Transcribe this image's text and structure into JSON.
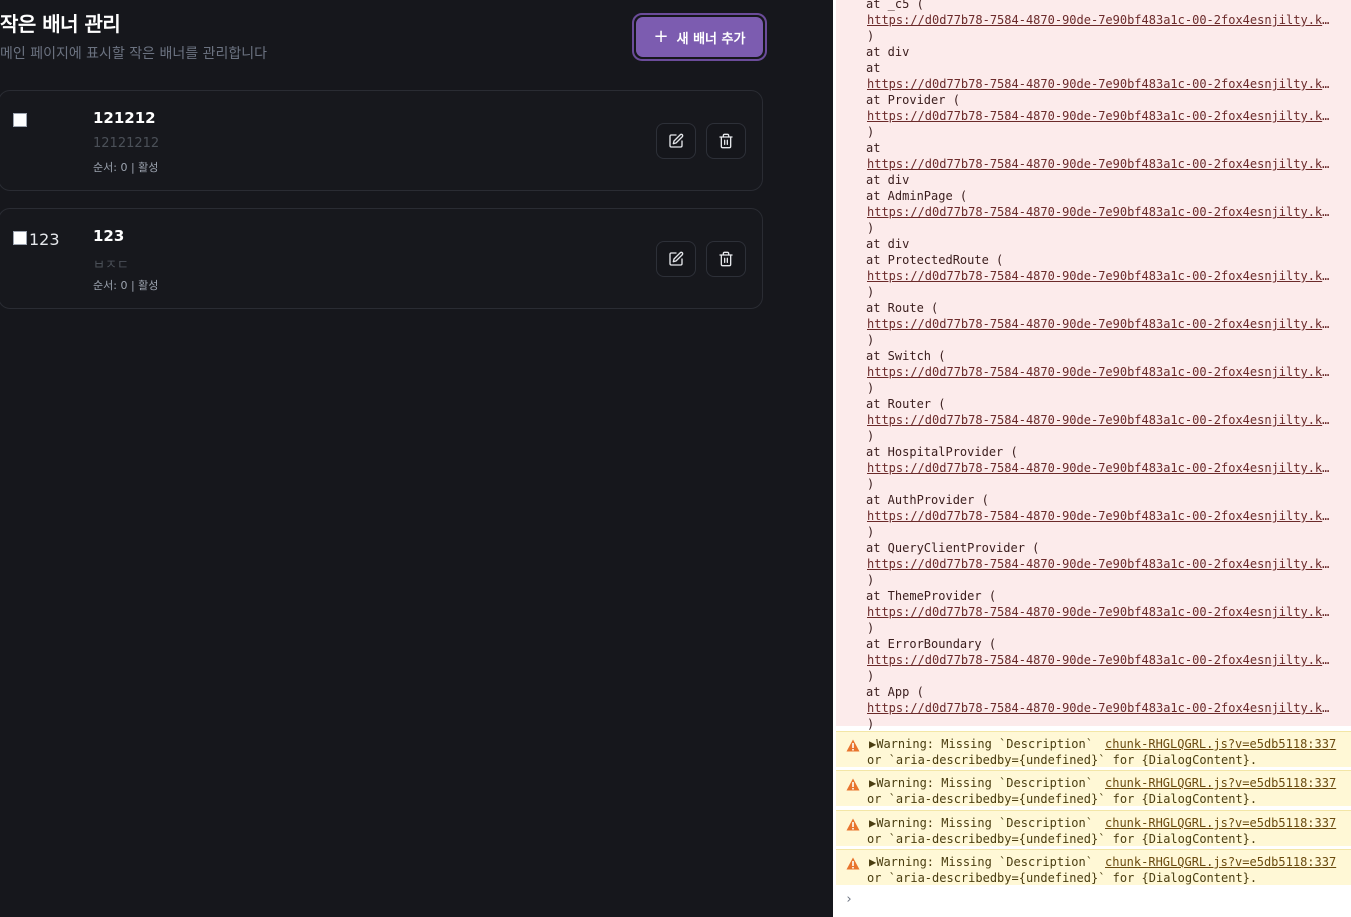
{
  "header": {
    "title": "작은 배너 관리",
    "subtitle": "메인 페이지에 표시할 작은 배너를 관리합니다",
    "add_button_label": "새 배너 추가"
  },
  "banners": [
    {
      "image_alt": "121212",
      "title": "121212",
      "description": "12121212",
      "meta": "순서: 0 | 활성"
    },
    {
      "image_alt": "123",
      "title": "123",
      "description": "ㅂㅈㄷ",
      "meta": "순서: 0 | 활성"
    }
  ],
  "console": {
    "trace": [
      {
        "at": "at _c5 (",
        "link": "https://d0d77b78-7584-4870-90de-7e90bf483a1c-00-2fox4esnjilty.kirk.replit.dev/src/components/ui/dialog.tsx",
        "close": ")"
      },
      {
        "at": "at div",
        "link": null,
        "close": null
      },
      {
        "at": "at",
        "link": "https://d0d77b78-7584-4870-90de-7e90bf483a1c-00-2fox4esnjilty.kirk.replit.dev/node_modules/.vite/deps/chunk.js",
        "close": null
      },
      {
        "at": "at Provider (",
        "link": "https://d0d77b78-7584-4870-90de-7e90bf483a1c-00-2fox4esnjilty.kirk.replit.dev/node_modules/.vite/deps/chunk.js",
        "close": ")"
      },
      {
        "at": "at",
        "link": "https://d0d77b78-7584-4870-90de-7e90bf483a1c-00-2fox4esnjilty.kirk.replit.dev/node_modules/.vite/deps/chunk.js",
        "close": null
      },
      {
        "at": "at div",
        "link": null,
        "close": null
      },
      {
        "at": "at AdminPage (",
        "link": "https://d0d77b78-7584-4870-90de-7e90bf483a1c-00-2fox4esnjilty.kirk.replit.dev/src/pages/admin.tsx",
        "close": ")"
      },
      {
        "at": "at div",
        "link": null,
        "close": null
      },
      {
        "at": "at ProtectedRoute (",
        "link": "https://d0d77b78-7584-4870-90de-7e90bf483a1c-00-2fox4esnjilty.kirk.replit.dev/src/lib/protected-route.tsx",
        "close": ")"
      },
      {
        "at": "at Route (",
        "link": "https://d0d77b78-7584-4870-90de-7e90bf483a1c-00-2fox4esnjilty.kirk.replit.dev/node_modules/.vite/deps/wouter.js",
        "close": ")"
      },
      {
        "at": "at Switch (",
        "link": "https://d0d77b78-7584-4870-90de-7e90bf483a1c-00-2fox4esnjilty.kirk.replit.dev/node_modules/.vite/deps/wouter.js",
        "close": ")"
      },
      {
        "at": "at Router (",
        "link": "https://d0d77b78-7584-4870-90de-7e90bf483a1c-00-2fox4esnjilty.kirk.replit.dev/src/App.tsx",
        "close": ")"
      },
      {
        "at": "at HospitalProvider (",
        "link": "https://d0d77b78-7584-4870-90de-7e90bf483a1c-00-2fox4esnjilty.kirk.replit.dev/src/hooks/use-hospital.tsx",
        "close": ")"
      },
      {
        "at": "at AuthProvider (",
        "link": "https://d0d77b78-7584-4870-90de-7e90bf483a1c-00-2fox4esnjilty.kirk.replit.dev/src/hooks/use-auth.tsx",
        "close": ")"
      },
      {
        "at": "at QueryClientProvider (",
        "link": "https://d0d77b78-7584-4870-90de-7e90bf483a1c-00-2fox4esnjilty.kirk.replit.dev/node_modules/.vite/deps/@tanstack_react-query.js",
        "close": ")"
      },
      {
        "at": "at ThemeProvider (",
        "link": "https://d0d77b78-7584-4870-90de-7e90bf483a1c-00-2fox4esnjilty.kirk.replit.dev/src/components/theme-provider.tsx",
        "close": ")"
      },
      {
        "at": "at ErrorBoundary (",
        "link": "https://d0d77b78-7584-4870-90de-7e90bf483a1c-00-2fox4esnjilty.kirk.replit.dev/src/components/error-boundary.tsx",
        "close": ")"
      },
      {
        "at": "at App (",
        "link": "https://d0d77b78-7584-4870-90de-7e90bf483a1c-00-2fox4esnjilty.kirk.replit.dev/src/App.tsx",
        "close": ")"
      }
    ],
    "warnings": [
      {
        "line1": "▶Warning: Missing `Description`",
        "line2": "or `aria-describedby={undefined}` for {DialogContent}.",
        "source": "chunk-RHGLQGRL.js?v=e5db5118:337"
      },
      {
        "line1": "▶Warning: Missing `Description`",
        "line2": "or `aria-describedby={undefined}` for {DialogContent}.",
        "source": "chunk-RHGLQGRL.js?v=e5db5118:337"
      },
      {
        "line1": "▶Warning: Missing `Description`",
        "line2": "or `aria-describedby={undefined}` for {DialogContent}.",
        "source": "chunk-RHGLQGRL.js?v=e5db5118:337"
      },
      {
        "line1": "▶Warning: Missing `Description`",
        "line2": "or `aria-describedby={undefined}` for {DialogContent}.",
        "source": "chunk-RHGLQGRL.js?v=e5db5118:337"
      }
    ],
    "prompt": "›"
  }
}
